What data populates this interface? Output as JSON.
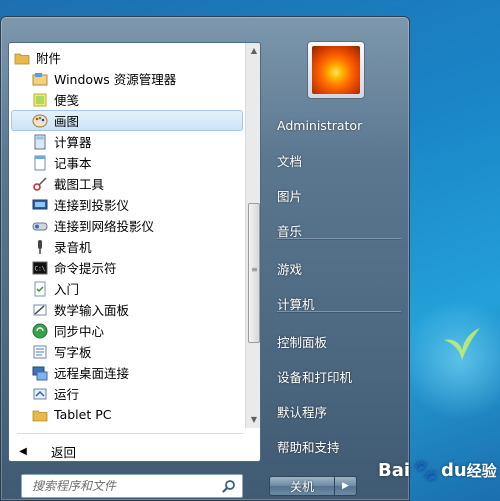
{
  "programs": {
    "items": [
      {
        "label": "附件",
        "icon": "folder-icon",
        "type": "folder",
        "selected": false
      },
      {
        "label": "Windows 资源管理器",
        "icon": "explorer-icon",
        "type": "sub",
        "selected": false
      },
      {
        "label": "便笺",
        "icon": "sticky-notes-icon",
        "type": "sub",
        "selected": false
      },
      {
        "label": "画图",
        "icon": "paint-icon",
        "type": "sub",
        "selected": true
      },
      {
        "label": "计算器",
        "icon": "calculator-icon",
        "type": "sub",
        "selected": false
      },
      {
        "label": "记事本",
        "icon": "notepad-icon",
        "type": "sub",
        "selected": false
      },
      {
        "label": "截图工具",
        "icon": "snipping-tool-icon",
        "type": "sub",
        "selected": false
      },
      {
        "label": "连接到投影仪",
        "icon": "projector-icon",
        "type": "sub",
        "selected": false
      },
      {
        "label": "连接到网络投影仪",
        "icon": "network-projector-icon",
        "type": "sub",
        "selected": false
      },
      {
        "label": "录音机",
        "icon": "microphone-icon",
        "type": "sub",
        "selected": false
      },
      {
        "label": "命令提示符",
        "icon": "command-prompt-icon",
        "type": "sub",
        "selected": false
      },
      {
        "label": "入门",
        "icon": "getting-started-icon",
        "type": "sub",
        "selected": false
      },
      {
        "label": "数学输入面板",
        "icon": "math-input-icon",
        "type": "sub",
        "selected": false
      },
      {
        "label": "同步中心",
        "icon": "sync-center-icon",
        "type": "sub",
        "selected": false
      },
      {
        "label": "写字板",
        "icon": "wordpad-icon",
        "type": "sub",
        "selected": false
      },
      {
        "label": "远程桌面连接",
        "icon": "remote-desktop-icon",
        "type": "sub",
        "selected": false
      },
      {
        "label": "运行",
        "icon": "run-icon",
        "type": "sub",
        "selected": false
      },
      {
        "label": "Tablet PC",
        "icon": "folder-icon",
        "type": "sub",
        "selected": false
      }
    ],
    "back_label": "返回"
  },
  "search": {
    "placeholder": "搜索程序和文件"
  },
  "right_pane": {
    "items": [
      "Administrator",
      "文档",
      "图片",
      "音乐",
      "游戏",
      "计算机",
      "控制面板",
      "设备和打印机",
      "默认程序",
      "帮助和支持"
    ]
  },
  "shutdown": {
    "label": "关机"
  },
  "watermark": {
    "brand": "Bai",
    "brand2": "du",
    "cn": "经验"
  },
  "colors": {
    "menu": "#5b7790",
    "selected": "#cde4f7",
    "accent": "#1a86c7"
  }
}
